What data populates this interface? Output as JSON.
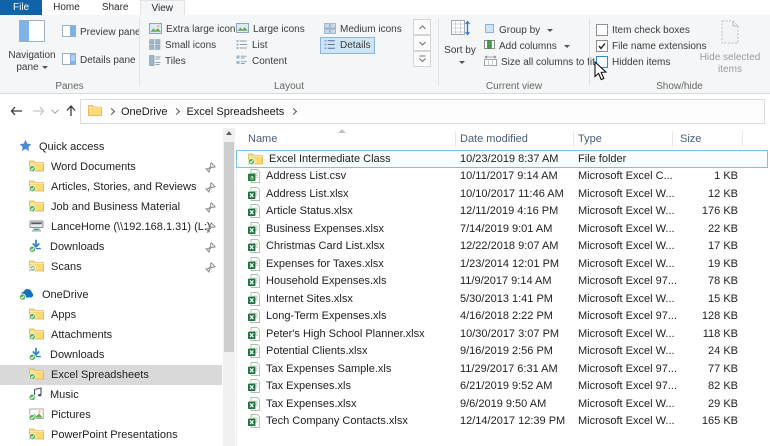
{
  "colors": {
    "file_tab_blue": "#1063a9",
    "excel_green": "#1f7244",
    "selection_border": "#7cc0ea",
    "sidebar_selected": "#d9d9d9"
  },
  "ribbon": {
    "tabs": [
      "File",
      "Home",
      "Share",
      "View"
    ],
    "active_tab": "View",
    "groups": {
      "panes": {
        "label": "Panes",
        "navigation_pane": "Navigation pane",
        "preview_pane": "Preview pane",
        "details_pane": "Details pane"
      },
      "layout": {
        "label": "Layout",
        "selected": "Details",
        "items": [
          {
            "label": "Extra large icons",
            "icon": "picture-xl-icon"
          },
          {
            "label": "Small icons",
            "icon": "grid-small-icon"
          },
          {
            "label": "Tiles",
            "icon": "tiles-icon"
          },
          {
            "label": "Large icons",
            "icon": "picture-lg-icon"
          },
          {
            "label": "List",
            "icon": "list-icon"
          },
          {
            "label": "Content",
            "icon": "content-icon"
          },
          {
            "label": "Medium icons",
            "icon": "grid-medium-icon"
          },
          {
            "label": "Details",
            "icon": "details-icon"
          }
        ]
      },
      "current_view": {
        "label": "Current view",
        "sort_by": "Sort by",
        "group_by": "Group by",
        "add_columns": "Add columns",
        "size_all_columns": "Size all columns to fit"
      },
      "show_hide": {
        "label": "Show/hide",
        "hide_selected_items": "Hide selected items",
        "checkboxes": [
          {
            "label": "Item check boxes",
            "checked": false,
            "hover": false
          },
          {
            "label": "File name extensions",
            "checked": true,
            "hover": false
          },
          {
            "label": "Hidden items",
            "checked": false,
            "hover": true
          }
        ]
      }
    }
  },
  "address_bar": {
    "path": [
      "OneDrive",
      "Excel Spreadsheets"
    ]
  },
  "sidebar": {
    "sections": [
      {
        "label": "Quick access",
        "icon": "star",
        "items": [
          {
            "label": "Word Documents",
            "icon": "folder-sync",
            "pinned": true
          },
          {
            "label": "Articles, Stories, and Reviews",
            "icon": "folder-sync",
            "pinned": true
          },
          {
            "label": "Job and Business Material",
            "icon": "folder-sync",
            "pinned": true
          },
          {
            "label": "LanceHome (\\\\192.168.1.31) (L:)",
            "icon": "network-drive",
            "pinned": true
          },
          {
            "label": "Downloads",
            "icon": "downloads-sync",
            "pinned": true
          },
          {
            "label": "Scans",
            "icon": "folder-refresh",
            "pinned": true
          }
        ]
      },
      {
        "label": "OneDrive",
        "icon": "onedrive-cloud",
        "items": [
          {
            "label": "Apps",
            "icon": "folder-sync",
            "pinned": false
          },
          {
            "label": "Attachments",
            "icon": "folder-sync",
            "pinned": false
          },
          {
            "label": "Downloads",
            "icon": "downloads-sync",
            "pinned": false
          },
          {
            "label": "Excel Spreadsheets",
            "icon": "folder-sync",
            "pinned": false,
            "selected": true
          },
          {
            "label": "Music",
            "icon": "music-sync",
            "pinned": false
          },
          {
            "label": "Pictures",
            "icon": "pictures-sync",
            "pinned": false
          },
          {
            "label": "PowerPoint Presentations",
            "icon": "folder-sync",
            "pinned": false
          }
        ]
      }
    ]
  },
  "file_list": {
    "columns": [
      "Name",
      "Date modified",
      "Type",
      "Size"
    ],
    "sort_column": "Name",
    "rows": [
      {
        "name": "Excel Intermediate Class",
        "date_modified": "10/23/2019 8:37 AM",
        "type": "File folder",
        "size": "",
        "icon": "folder-sync",
        "selected": true
      },
      {
        "name": "Address List.csv",
        "date_modified": "10/11/2017 9:14 AM",
        "type": "Microsoft Excel C...",
        "size": "1 KB",
        "icon": "excel-csv",
        "selected": false
      },
      {
        "name": "Address List.xlsx",
        "date_modified": "10/10/2017 11:46 AM",
        "type": "Microsoft Excel W...",
        "size": "12 KB",
        "icon": "excel",
        "selected": false
      },
      {
        "name": "Article Status.xlsx",
        "date_modified": "12/11/2019 4:16 PM",
        "type": "Microsoft Excel W...",
        "size": "176 KB",
        "icon": "excel",
        "selected": false
      },
      {
        "name": "Business Expenses.xlsx",
        "date_modified": "7/14/2019 9:01 AM",
        "type": "Microsoft Excel W...",
        "size": "22 KB",
        "icon": "excel",
        "selected": false
      },
      {
        "name": "Christmas Card List.xlsx",
        "date_modified": "12/22/2018 9:07 AM",
        "type": "Microsoft Excel W...",
        "size": "17 KB",
        "icon": "excel",
        "selected": false
      },
      {
        "name": "Expenses for Taxes.xlsx",
        "date_modified": "1/23/2014 12:01 PM",
        "type": "Microsoft Excel W...",
        "size": "19 KB",
        "icon": "excel",
        "selected": false
      },
      {
        "name": "Household Expenses.xls",
        "date_modified": "11/9/2017 9:14 AM",
        "type": "Microsoft Excel 97...",
        "size": "78 KB",
        "icon": "excel",
        "selected": false
      },
      {
        "name": "Internet Sites.xlsx",
        "date_modified": "5/30/2013 1:41 PM",
        "type": "Microsoft Excel W...",
        "size": "15 KB",
        "icon": "excel",
        "selected": false
      },
      {
        "name": "Long-Term Expenses.xls",
        "date_modified": "4/16/2018 2:22 PM",
        "type": "Microsoft Excel 97...",
        "size": "128 KB",
        "icon": "excel",
        "selected": false
      },
      {
        "name": "Peter's High School Planner.xlsx",
        "date_modified": "10/30/2017 3:07 PM",
        "type": "Microsoft Excel W...",
        "size": "118 KB",
        "icon": "excel",
        "selected": false
      },
      {
        "name": "Potential Clients.xlsx",
        "date_modified": "9/16/2019 2:56 PM",
        "type": "Microsoft Excel W...",
        "size": "24 KB",
        "icon": "excel",
        "selected": false
      },
      {
        "name": "Tax Expenses Sample.xls",
        "date_modified": "11/29/2017 6:31 AM",
        "type": "Microsoft Excel 97...",
        "size": "77 KB",
        "icon": "excel",
        "selected": false
      },
      {
        "name": "Tax Expenses.xls",
        "date_modified": "6/21/2019 9:52 AM",
        "type": "Microsoft Excel 97...",
        "size": "82 KB",
        "icon": "excel",
        "selected": false
      },
      {
        "name": "Tax Expenses.xlsx",
        "date_modified": "9/6/2019 9:50 AM",
        "type": "Microsoft Excel W...",
        "size": "29 KB",
        "icon": "excel",
        "selected": false
      },
      {
        "name": "Tech Company Contacts.xlsx",
        "date_modified": "12/14/2017 12:39 PM",
        "type": "Microsoft Excel W...",
        "size": "165 KB",
        "icon": "excel",
        "selected": false
      }
    ]
  }
}
